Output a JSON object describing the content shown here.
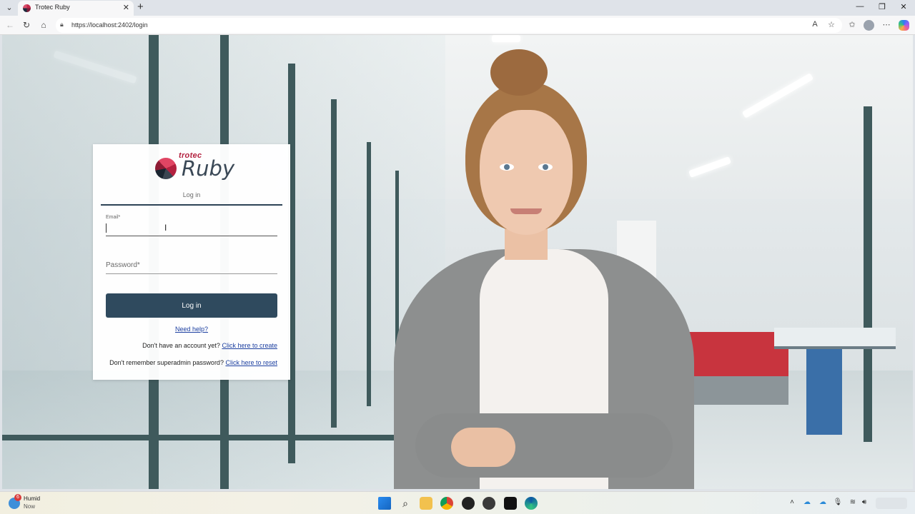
{
  "browser": {
    "tab_title": "Trotec Ruby",
    "new_tab_label": "+",
    "url": "https://localhost:2402/login"
  },
  "login": {
    "brand": "trotec",
    "product": "Ruby",
    "tab_label": "Log in",
    "email_label": "Email*",
    "email_value": "",
    "password_placeholder": "Password*",
    "login_button": "Log in",
    "need_help": "Need help?",
    "no_account_text": "Don't have an account yet?",
    "create_link": "Click here to create",
    "forgot_text": "Don't remember superadmin password?",
    "reset_link": "Click here to reset"
  },
  "taskbar": {
    "weather_title": "Humid",
    "weather_sub": "Now",
    "badge_count": "6"
  },
  "colors": {
    "primary_button": "#2f4a5e",
    "brand_red": "#b3213f",
    "link": "#1c3fa0"
  },
  "icons": [
    "tab-menu-icon",
    "close-icon",
    "back-icon",
    "refresh-icon",
    "home-icon",
    "lock-icon",
    "read-aloud-icon",
    "favorite-icon",
    "favorites-list-icon",
    "profile-icon",
    "more-icon",
    "copilot-icon",
    "windows-start-icon",
    "search-icon",
    "file-explorer-icon",
    "chrome-icon",
    "edge-icon",
    "wifi-icon",
    "volume-icon"
  ]
}
